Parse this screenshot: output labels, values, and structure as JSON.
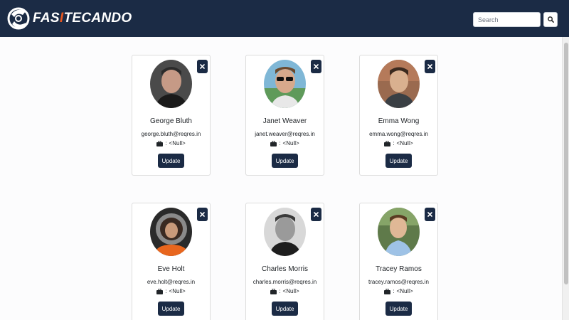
{
  "header": {
    "brand_part1": "FAS",
    "brand_highlight": "I",
    "brand_part2": "TECANDO",
    "search_placeholder": "Search",
    "search_icon": "search-icon",
    "brand_color": "#1b2b45",
    "accent_color": "#e8571f"
  },
  "users": [
    {
      "name": "George Bluth",
      "email": "george.bluth@reqres.in",
      "job_separator": ":",
      "job": "<Null>",
      "update_label": "Update"
    },
    {
      "name": "Janet Weaver",
      "email": "janet.weaver@reqres.in",
      "job_separator": ":",
      "job": "<Null>",
      "update_label": "Update"
    },
    {
      "name": "Emma Wong",
      "email": "emma.wong@reqres.in",
      "job_separator": ":",
      "job": "<Null>",
      "update_label": "Update"
    },
    {
      "name": "Eve Holt",
      "email": "eve.holt@reqres.in",
      "job_separator": ":",
      "job": "<Null>",
      "update_label": "Update"
    },
    {
      "name": "Charles Morris",
      "email": "charles.morris@reqres.in",
      "job_separator": ":",
      "job": "<Null>",
      "update_label": "Update"
    },
    {
      "name": "Tracey Ramos",
      "email": "tracey.ramos@reqres.in",
      "job_separator": ":",
      "job": "<Null>",
      "update_label": "Update"
    }
  ],
  "icons": {
    "delete": "close-icon",
    "job": "briefcase-icon"
  }
}
